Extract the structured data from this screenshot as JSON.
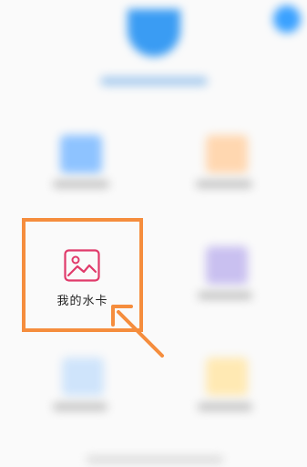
{
  "screen": {
    "background": "#fafafa"
  },
  "header": {
    "logo_icon": "app-logo-icon",
    "corner_icon": "profile-dot-icon",
    "brand_color": "#3a9cf3"
  },
  "grid": {
    "items": [
      {
        "id": "tile-1",
        "label": "",
        "icon": "document-icon",
        "color": "#8ec3ff"
      },
      {
        "id": "tile-2",
        "label": "",
        "icon": "gift-icon",
        "color": "#ffd7b0"
      },
      {
        "id": "tile-3",
        "label": "我的水卡",
        "icon": "image-icon",
        "color": "#e03a6a",
        "highlighted": true
      },
      {
        "id": "tile-4",
        "label": "",
        "icon": "card-icon",
        "color": "#c9c0f0"
      },
      {
        "id": "tile-5",
        "label": "",
        "icon": "droplet-icon",
        "color": "#cfe4fb"
      },
      {
        "id": "tile-6",
        "label": "",
        "icon": "wallet-icon",
        "color": "#ffe9b3"
      }
    ]
  },
  "annotation": {
    "highlight_color": "#f58d3d",
    "arrow_icon": "pointer-arrow-icon"
  }
}
